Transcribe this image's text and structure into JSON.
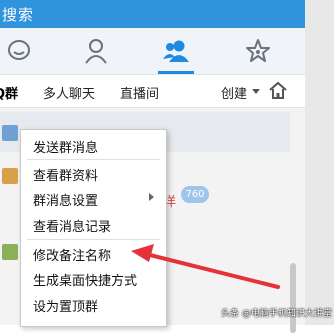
{
  "search": {
    "text": "搜索"
  },
  "sub_tabs": {
    "groups": "Q群",
    "multi_chat": "多人聊天",
    "live": "直播间",
    "create": "创建"
  },
  "context_menu": {
    "items": [
      {
        "label": "发送群消息"
      },
      {
        "label": "查看群资料"
      },
      {
        "label": "群消息设置",
        "has_submenu": true
      },
      {
        "label": "查看消息记录"
      },
      {
        "label": "修改备注名称"
      },
      {
        "label": "生成桌面快捷方式"
      },
      {
        "label": "设为置顶群"
      }
    ]
  },
  "list": {
    "partial_text": "洋",
    "badge": "760"
  },
  "annotation": {
    "color": "#e5323a"
  },
  "watermark": "头条 @电脑手机知识大讲堂",
  "colors": {
    "topbar": "#2f94dc",
    "accent": "#1e8be0"
  }
}
